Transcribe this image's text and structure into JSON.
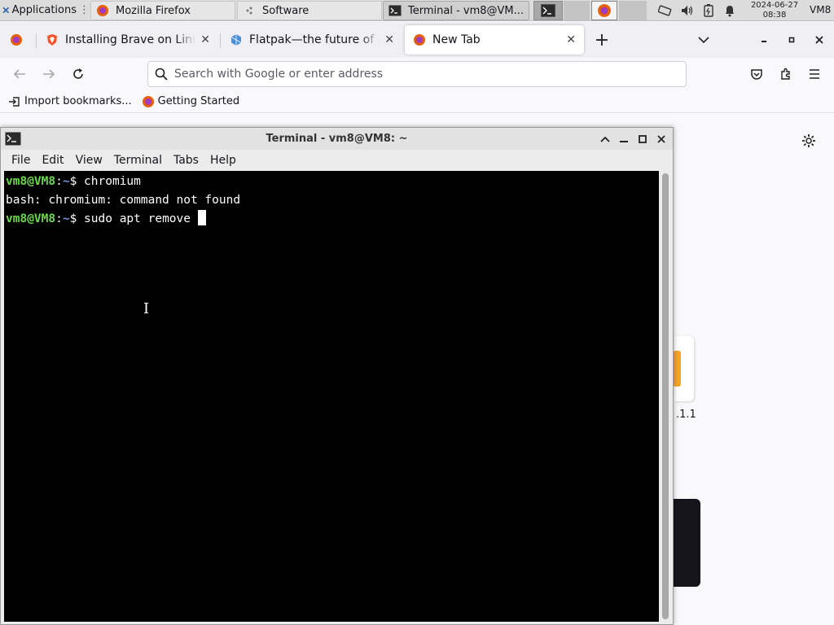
{
  "panel": {
    "applications_label": "Applications",
    "tasks": [
      {
        "label": "Mozilla Firefox"
      },
      {
        "label": "Software"
      },
      {
        "label": "Terminal - vm8@VM..."
      }
    ],
    "clock_date": "2024-06-27",
    "clock_time": "08:38",
    "user_label": "VM8"
  },
  "firefox": {
    "tabs": [
      {
        "title": "Installing Brave on Linux",
        "close": "✕"
      },
      {
        "title": "Flatpak—the future of application distribution",
        "close": "✕"
      },
      {
        "title": "New Tab",
        "close": "✕"
      }
    ],
    "new_tab_symbol": "+",
    "url_placeholder": "Search with Google or enter address",
    "bookmarks": [
      {
        "label": "Import bookmarks..."
      },
      {
        "label": "Getting Started"
      }
    ],
    "peek_text": ".1.1"
  },
  "terminal": {
    "title": "Terminal - vm8@VM8: ~",
    "menu": [
      "File",
      "Edit",
      "View",
      "Terminal",
      "Tabs",
      "Help"
    ],
    "lines": [
      {
        "user": "vm8@VM8",
        "sep": ":",
        "path": "~",
        "dollar": "$ ",
        "cmd": "chromium"
      },
      {
        "output": "bash: chromium: command not found"
      },
      {
        "user": "vm8@VM8",
        "sep": ":",
        "path": "~",
        "dollar": "$ ",
        "cmd": "sudo apt remove "
      }
    ]
  },
  "colors": {
    "prompt_green": "#6ad84b",
    "prompt_blue": "#7a8fe0",
    "terminal_bg": "#000000",
    "panel_bg": "#dcdcdc",
    "firefox_toolbar": "#f9f9fb"
  },
  "icons": [
    "xfce-logo-icon",
    "firefox-icon",
    "software-icon",
    "terminal-icon",
    "network-icon",
    "volume-icon",
    "battery-icon",
    "bell-icon",
    "brave-icon",
    "flatpak-icon",
    "back-icon",
    "forward-icon",
    "reload-icon",
    "search-icon",
    "pocket-icon",
    "extensions-icon",
    "hamburger-menu-icon",
    "gear-icon",
    "import-icon",
    "chevron-down-icon",
    "minimize-icon",
    "maximize-icon",
    "close-icon",
    "chevron-up-icon"
  ]
}
